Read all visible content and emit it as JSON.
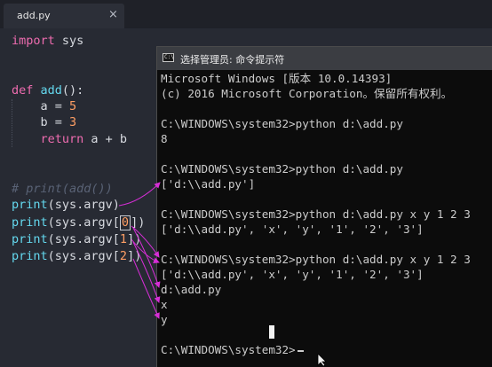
{
  "tab": {
    "title": "add.py",
    "close": "×"
  },
  "code": {
    "import_kw": "import",
    "import_mod": " sys",
    "def_kw": "def",
    "func_name": "add",
    "def_rest": "():",
    "a_name": "a = ",
    "a_value": "5",
    "b_name": "b = ",
    "b_value": "3",
    "return_kw": "return",
    "return_rest": " a + b",
    "comment": "# print(add())",
    "print1_fn": "print",
    "print1_rest": "(sys.argv)",
    "print2_fn": "print",
    "print2_pre": "(sys.argv[",
    "print2_idx": "0",
    "print2_post": "])",
    "print3_fn": "print",
    "print3_pre": "(sys.argv[",
    "print3_idx": "1",
    "print3_post": "])",
    "print4_fn": "print",
    "print4_pre": "(sys.argv[",
    "print4_idx": "2",
    "print4_post": "])"
  },
  "console": {
    "title": "选择管理员: 命令提示符",
    "icon_label": "C:\\",
    "lines": [
      "Microsoft Windows [版本 10.0.14393]",
      "(c) 2016 Microsoft Corporation。保留所有权利。",
      "",
      "C:\\WINDOWS\\system32>python d:\\add.py",
      "8",
      "",
      "C:\\WINDOWS\\system32>python d:\\add.py",
      "['d:\\\\add.py']",
      "",
      "C:\\WINDOWS\\system32>python d:\\add.py x y 1 2 3",
      "['d:\\\\add.py', 'x', 'y', '1', '2', '3']",
      "",
      "C:\\WINDOWS\\system32>python d:\\add.py x y 1 2 3",
      "['d:\\\\add.py', 'x', 'y', '1', '2', '3']",
      "d:\\add.py",
      "x",
      "y",
      "",
      "C:\\WINDOWS\\system32>"
    ]
  },
  "colors": {
    "annotation_arrow": "#d62ed6",
    "keyword": "#ef6cb0",
    "function": "#64d8ee",
    "number": "#ff9e64"
  }
}
